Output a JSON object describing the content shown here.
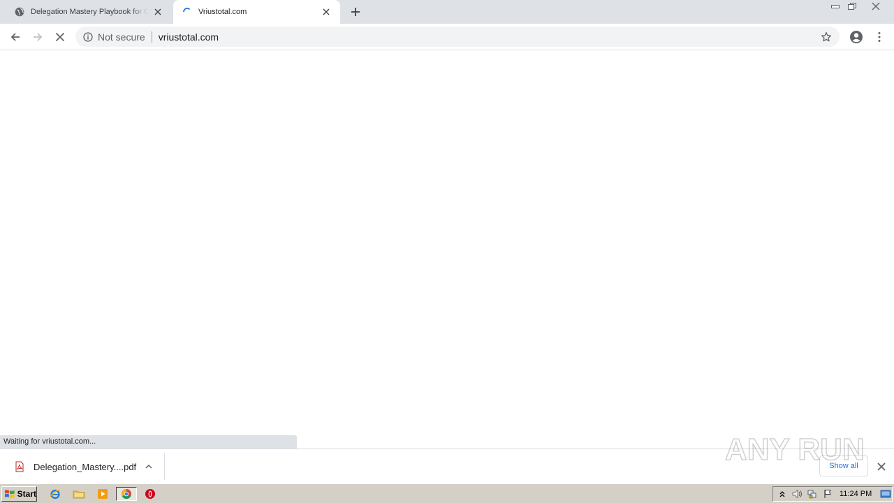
{
  "tabs": [
    {
      "title": "Delegation Mastery Playbook for CEOs",
      "state": "inactive"
    },
    {
      "title": "Vriustotal.com",
      "state": "loading"
    }
  ],
  "toolbar": {
    "security_label": "Not secure",
    "url": "vriustotal.com"
  },
  "status_text": "Waiting for vriustotal.com...",
  "download_shelf": {
    "filename": "Delegation_Mastery....pdf",
    "show_all_label": "Show all"
  },
  "watermark": {
    "text": "ANY RUN"
  },
  "taskbar": {
    "start_label": "Start",
    "clock": "11:24 PM"
  },
  "colors": {
    "tab_strip": "#dee1e6",
    "omnibox": "#f1f3f4",
    "link_blue": "#1a73e8",
    "taskbar": "#d4d0c8"
  }
}
